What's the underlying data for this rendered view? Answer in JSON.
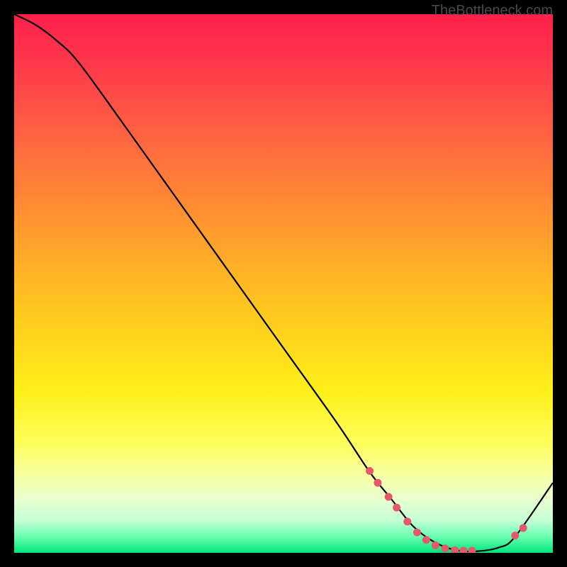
{
  "watermark": "TheBottleneck.com",
  "chart_data": {
    "type": "line",
    "title": "",
    "xlabel": "",
    "ylabel": "",
    "xlim": [
      0,
      100
    ],
    "ylim": [
      0,
      100
    ],
    "series": [
      {
        "name": "bottleneck-curve",
        "x": [
          0,
          4,
          8,
          12,
          20,
          30,
          40,
          50,
          60,
          66,
          70,
          74,
          78,
          82,
          86,
          90,
          93,
          100
        ],
        "y": [
          100,
          98,
          95,
          91,
          80,
          66,
          52,
          38,
          24,
          15,
          10,
          5,
          2,
          0.5,
          0.3,
          1,
          3,
          13
        ]
      }
    ],
    "markers": {
      "name": "highlight-dots",
      "color": "#e55a6a",
      "x": [
        66,
        67.5,
        69.5,
        71,
        73,
        74.8,
        76.5,
        78.2,
        80,
        81.8,
        83.4,
        85,
        93,
        94.5
      ],
      "y": [
        15.2,
        13.0,
        10.4,
        8.4,
        5.8,
        3.8,
        2.4,
        1.4,
        0.8,
        0.5,
        0.4,
        0.4,
        3.2,
        4.6
      ]
    },
    "gradient_stops": [
      {
        "pos": 0,
        "color": "#ff1f4b"
      },
      {
        "pos": 10,
        "color": "#ff3b4b"
      },
      {
        "pos": 25,
        "color": "#ff6b3f"
      },
      {
        "pos": 40,
        "color": "#ff9a2f"
      },
      {
        "pos": 55,
        "color": "#ffc81f"
      },
      {
        "pos": 70,
        "color": "#fff01a"
      },
      {
        "pos": 80,
        "color": "#fdff5e"
      },
      {
        "pos": 86,
        "color": "#f6ffa8"
      },
      {
        "pos": 90,
        "color": "#e9ffce"
      },
      {
        "pos": 94,
        "color": "#c4ffd6"
      },
      {
        "pos": 97,
        "color": "#6affb0"
      },
      {
        "pos": 100,
        "color": "#00e47a"
      }
    ]
  }
}
